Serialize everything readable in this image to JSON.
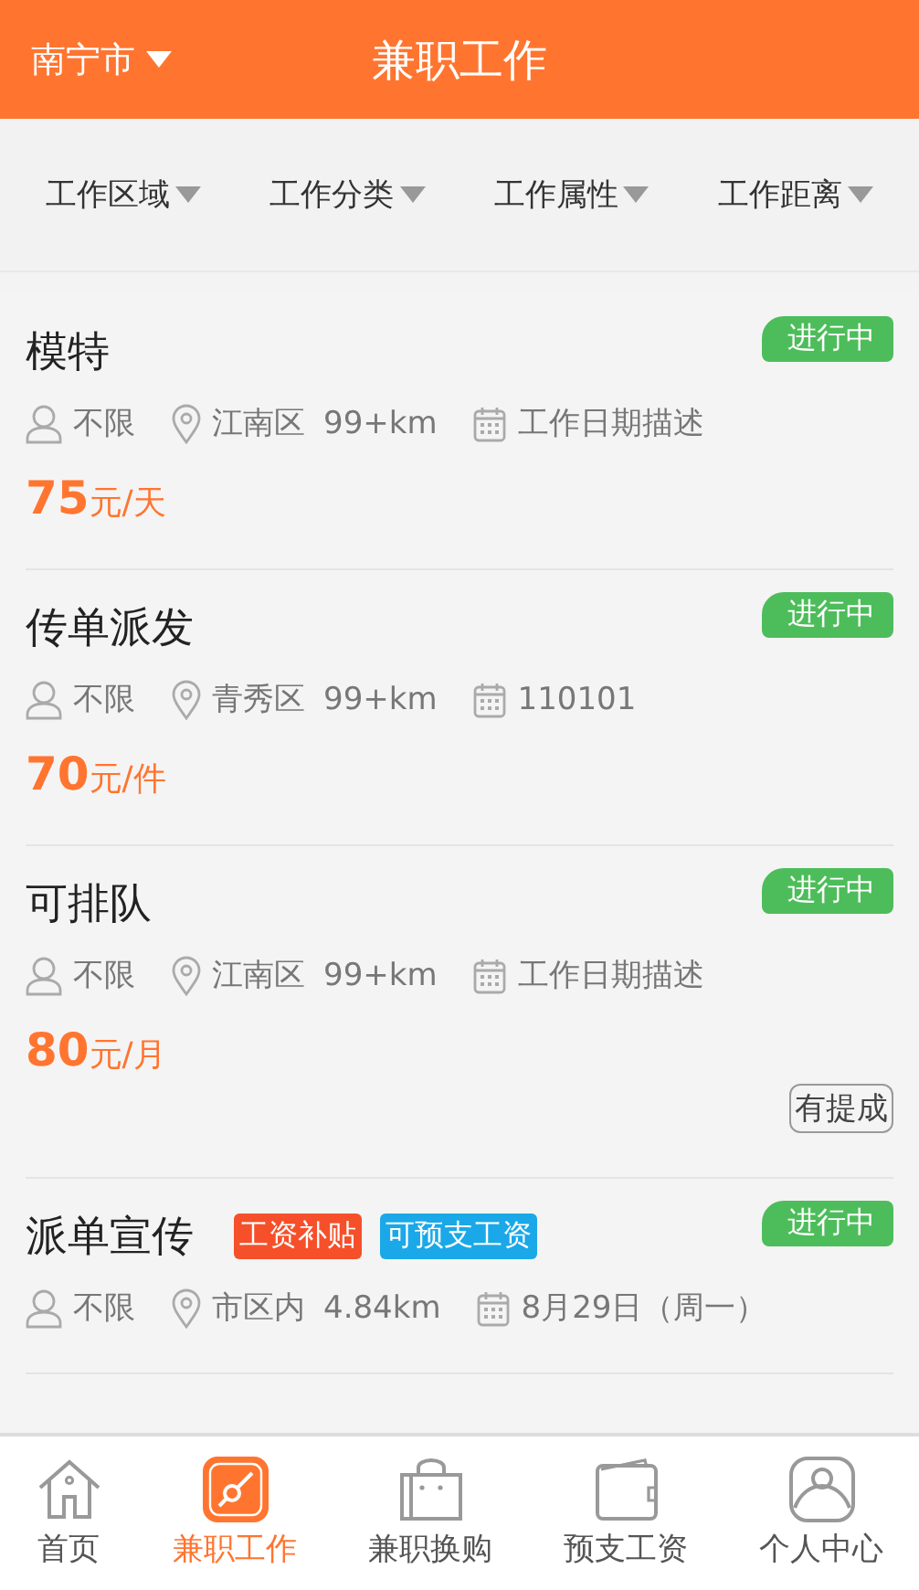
{
  "header": {
    "city": "南宁市",
    "title": "兼职工作"
  },
  "filters": [
    "工作区域",
    "工作分类",
    "工作属性",
    "工作距离"
  ],
  "jobs": [
    {
      "title": "模特",
      "status": "进行中",
      "people": "不限",
      "district": "江南区",
      "distance": "99+km",
      "date": "工作日期描述",
      "price": "75",
      "unit": "元/天"
    },
    {
      "title": "传单派发",
      "status": "进行中",
      "people": "不限",
      "district": "青秀区",
      "distance": "99+km",
      "date": "110101",
      "price": "70",
      "unit": "元/件"
    },
    {
      "title": "可排队",
      "status": "进行中",
      "people": "不限",
      "district": "江南区",
      "distance": "99+km",
      "date": "工作日期描述",
      "price": "80",
      "unit": "元/月",
      "extras": [
        "有提成"
      ]
    },
    {
      "title": "派单宣传",
      "tags": [
        {
          "text": "工资补贴",
          "color": "#f5502a"
        },
        {
          "text": "可预支工资",
          "color": "#1aa8e8"
        }
      ],
      "status": "进行中",
      "people": "不限",
      "district": "市区内",
      "distance": "4.84km",
      "date": "8月29日（周一）"
    }
  ],
  "nav": [
    {
      "label": "首页",
      "kind": "home",
      "selected": false
    },
    {
      "label": "兼职工作",
      "kind": "work",
      "selected": true
    },
    {
      "label": "兼职换购",
      "kind": "shop",
      "selected": false
    },
    {
      "label": "预支工资",
      "kind": "wallet",
      "selected": false
    },
    {
      "label": "个人中心",
      "kind": "user",
      "selected": false
    }
  ]
}
